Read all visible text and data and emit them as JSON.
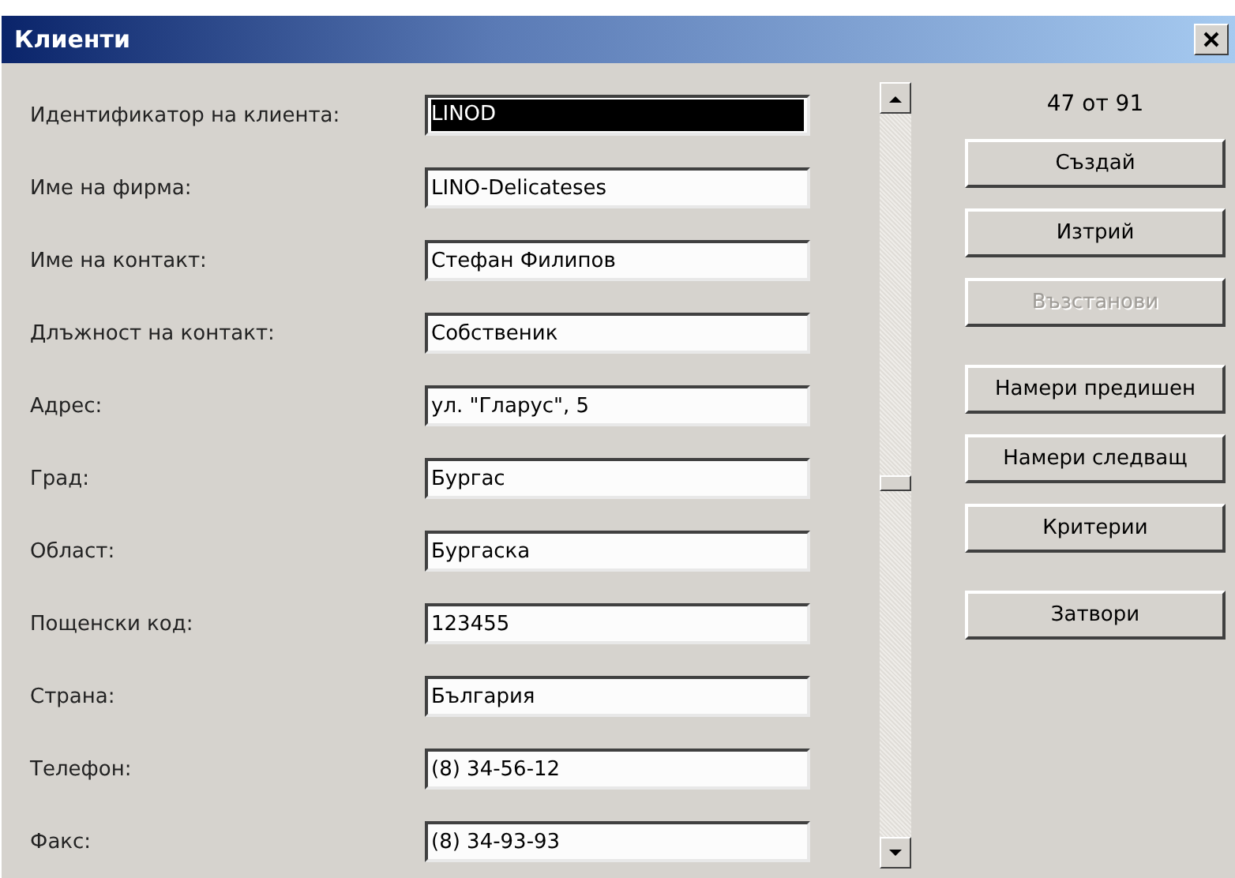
{
  "window": {
    "title": "Клиенти"
  },
  "fields": [
    {
      "label": "Идентификатор на клиента:",
      "value": "LINOD",
      "focused": true
    },
    {
      "label": "Име на фирма:",
      "value": "LINO-Delicateses",
      "focused": false
    },
    {
      "label": "Име на контакт:",
      "value": "Стефан Филипов",
      "focused": false
    },
    {
      "label": "Длъжност на контакт:",
      "value": "Собственик",
      "focused": false
    },
    {
      "label": "Адрес:",
      "value": "ул. \"Гларус\", 5",
      "focused": false
    },
    {
      "label": "Град:",
      "value": "Бургас",
      "focused": false
    },
    {
      "label": "Област:",
      "value": "Бургаска",
      "focused": false
    },
    {
      "label": "Пощенски код:",
      "value": "123455",
      "focused": false
    },
    {
      "label": "Страна:",
      "value": "България",
      "focused": false
    },
    {
      "label": "Телефон:",
      "value": "(8) 34-56-12",
      "focused": false
    },
    {
      "label": "Факс:",
      "value": "(8) 34-93-93",
      "focused": false
    }
  ],
  "scrollbar": {
    "level": 0.5
  },
  "record_counter": "47 от 91",
  "button_groups": [
    [
      {
        "label": "Създай",
        "disabled": false
      },
      {
        "label": "Изтрий",
        "disabled": false
      },
      {
        "label": "Възстанови",
        "disabled": true
      }
    ],
    [
      {
        "label": "Намери предишен",
        "disabled": false
      },
      {
        "label": "Намери следващ",
        "disabled": false
      },
      {
        "label": "Критерии",
        "disabled": false
      }
    ],
    [
      {
        "label": "Затвори",
        "disabled": false
      }
    ]
  ]
}
